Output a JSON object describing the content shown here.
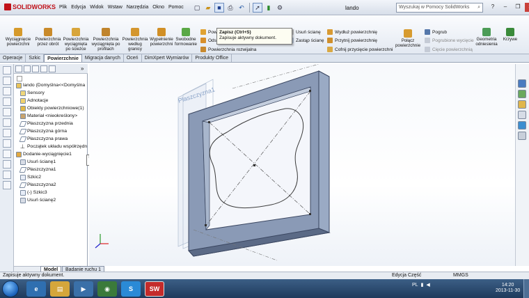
{
  "app": {
    "brand": "SOLIDWORKS",
    "document_title": "lando"
  },
  "menu": [
    "Plik",
    "Edycja",
    "Widok",
    "Wstaw",
    "Narzędzia",
    "Okno",
    "Pomoc"
  ],
  "search": {
    "placeholder": "Wyszukaj w Pomocy SolidWorks"
  },
  "tooltip": {
    "title": "Zapisz  (Ctrl+S)",
    "text": "Zapisuje aktywny dokument."
  },
  "command_buttons": [
    {
      "label": "Wyciągnięcie powierzchni",
      "icon": "extrude-surface-icon"
    },
    {
      "label": "Powierzchnia przez obrót",
      "icon": "revolve-surface-icon"
    },
    {
      "label": "Powierzchnia wyciągnięta po ścieżce",
      "icon": "swept-surface-icon"
    },
    {
      "label": "Powierzchnia wyciągnięta po profilach",
      "icon": "loft-surface-icon"
    },
    {
      "label": "Powierzchnia według granicy",
      "icon": "boundary-surface-icon"
    },
    {
      "label": "Wypełnienie powierzchni",
      "icon": "fill-surface-icon"
    },
    {
      "label": "Swobodne formowanie",
      "icon": "freeform-icon"
    }
  ],
  "command_rows": {
    "col1": [
      "Powierz...",
      "Odsunię...",
      "Powierzchnia rozwijalna"
    ],
    "col2": [
      "Usuń ścianę",
      "Zastąp ścianę"
    ],
    "col3": [
      "Wydłuż powierzchnię",
      "Przytnij powierzchnię",
      "Cofnij przycięcie powierzchni"
    ],
    "knit": "Połącz powierzchnie",
    "col4": [
      "Pogrub",
      "Pogrubione wycięcie",
      "Cięcie powierzchnią"
    ],
    "geom": "Geometria odniesienia",
    "curves": "Krzywe"
  },
  "tabs": [
    "Operacje",
    "Szkic",
    "Powierzchnie",
    "Migracja danych",
    "Oceń",
    "DimXpert Wymiarów",
    "Produkty Office"
  ],
  "active_tab": "Powierzchnie",
  "tree": [
    {
      "label": "lando  (Domyślna<<Domyślna",
      "level": 0
    },
    {
      "label": "Sensory",
      "level": 1
    },
    {
      "label": "Adnotacje",
      "level": 1
    },
    {
      "label": "Obiekty powierzchniowe(1)",
      "level": 1
    },
    {
      "label": "Materiał <nieokreślony>",
      "level": 1
    },
    {
      "label": "Płaszczyzna przednia",
      "level": 1
    },
    {
      "label": "Płaszczyzna górna",
      "level": 1
    },
    {
      "label": "Płaszczyzna prawa",
      "level": 1
    },
    {
      "label": "Początek układu współrzędn",
      "level": 1
    },
    {
      "label": "Dodanie-wyciągnięcie1",
      "level": 1
    },
    {
      "label": "Usuń ścianę1",
      "level": 1
    },
    {
      "label": "Płaszczyzna1",
      "level": 1
    },
    {
      "label": "Szkic2",
      "level": 1
    },
    {
      "label": "Płaszczyzna2",
      "level": 1
    },
    {
      "label": "(-) Szkic3",
      "level": 1
    },
    {
      "label": "Usuń ścianę2",
      "level": 1
    }
  ],
  "viewport_label": "Płaszczyzna1",
  "bottom_tabs": [
    "Model",
    "Badanie ruchu 1"
  ],
  "status": {
    "message": "Zapisuje aktywny dokument.",
    "mode": "Edycja Część",
    "units": "MMGS"
  },
  "taskbar": {
    "lang": "PL",
    "time": "14:20",
    "date": "2013-11-30"
  },
  "colors": {
    "accent": "#c1121a",
    "model_face": "#8a9ab6",
    "taskbar": "#2a4a70"
  }
}
